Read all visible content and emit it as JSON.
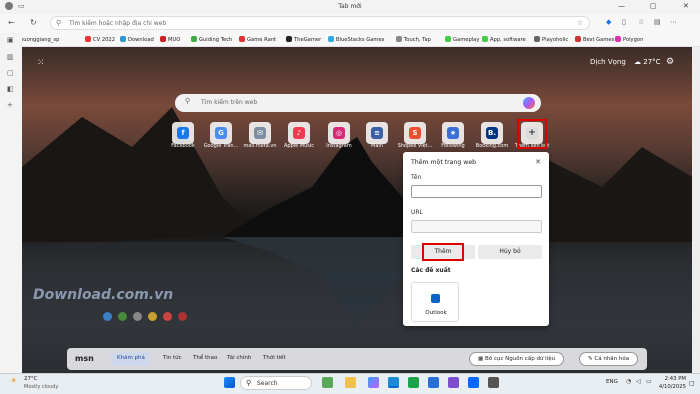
{
  "window": {
    "title": "Tab mới"
  },
  "address": {
    "placeholder": "Tìm kiếm hoặc nhập địa chỉ web"
  },
  "favorites": [
    {
      "label": "huonggiang_sp",
      "color": "#5a9"
    },
    {
      "label": "CV 2022",
      "color": "#e33"
    },
    {
      "label": "Download",
      "color": "#39c"
    },
    {
      "label": "MUO",
      "color": "#c22"
    },
    {
      "label": "Guiding Tech",
      "color": "#4a4"
    },
    {
      "label": "Game Rant",
      "color": "#d33"
    },
    {
      "label": "TheGamer",
      "color": "#222"
    },
    {
      "label": "BlueStacks Games",
      "color": "#3ad"
    },
    {
      "label": "Touch, Tap",
      "color": "#888"
    },
    {
      "label": "Gameplay",
      "color": "#4c4"
    },
    {
      "label": "App, software",
      "color": "#4c4"
    },
    {
      "label": "Playoholic",
      "color": "#666"
    },
    {
      "label": "Best Games",
      "color": "#c33"
    },
    {
      "label": "Polygon",
      "color": "#d3a"
    }
  ],
  "weather": {
    "location": "Dịch Vọng",
    "temp": "27°C"
  },
  "search": {
    "placeholder": "Tìm kiếm trên web"
  },
  "tiles": [
    {
      "label": "Facebook",
      "icon": "facebook-icon",
      "color": "#1877f2",
      "glyph": "f"
    },
    {
      "label": "Google Tran...",
      "icon": "google-translate-icon",
      "color": "#4a8af4",
      "glyph": "G"
    },
    {
      "label": "mail.meta.vn",
      "icon": "mail-icon",
      "color": "#7a8fa0",
      "glyph": "✉"
    },
    {
      "label": "Apple Music",
      "icon": "apple-music-icon",
      "color": "#f03a4f",
      "glyph": "♪"
    },
    {
      "label": "Instagram",
      "icon": "instagram-icon",
      "color": "#d62976",
      "glyph": "◎"
    },
    {
      "label": "Main",
      "icon": "main-icon",
      "color": "#3a5ea8",
      "glyph": "≡"
    },
    {
      "label": "Shopee Việt...",
      "icon": "shopee-icon",
      "color": "#ee4d2d",
      "glyph": "S"
    },
    {
      "label": "Following",
      "icon": "following-icon",
      "color": "#3a6fd8",
      "glyph": "★"
    },
    {
      "label": "Booking.com",
      "icon": "booking-icon",
      "color": "#003580",
      "glyph": "B."
    },
    {
      "label": "Thêm liên kết",
      "icon": "plus-icon",
      "color": "#dcdcdc",
      "glyph": "+"
    }
  ],
  "dialog": {
    "title": "Thêm một trang web",
    "name_label": "Tên",
    "name_value": "",
    "url_label": "URL",
    "url_value": "",
    "add_label": "Thêm",
    "cancel_label": "Hủy bỏ",
    "suggestions_label": "Các đề xuất",
    "suggestions": [
      {
        "label": "Outlook",
        "icon": "outlook-icon"
      }
    ]
  },
  "watermark": "Download.com.vn",
  "msn": {
    "logo": "msn",
    "tabs": [
      "Khám phá",
      "Tin tức",
      "Thể thao",
      "Tài chính",
      "Thời tiết"
    ],
    "layout_button": "Bố cục Nguồn cấp dữ liệu",
    "personalize_button": "Cá nhân hóa"
  },
  "taskbar": {
    "weather_temp": "27°C",
    "weather_desc": "Mostly cloudy",
    "search_placeholder": "Search",
    "lang": "ENG",
    "time": "2:43 PM",
    "date": "4/10/2025"
  }
}
